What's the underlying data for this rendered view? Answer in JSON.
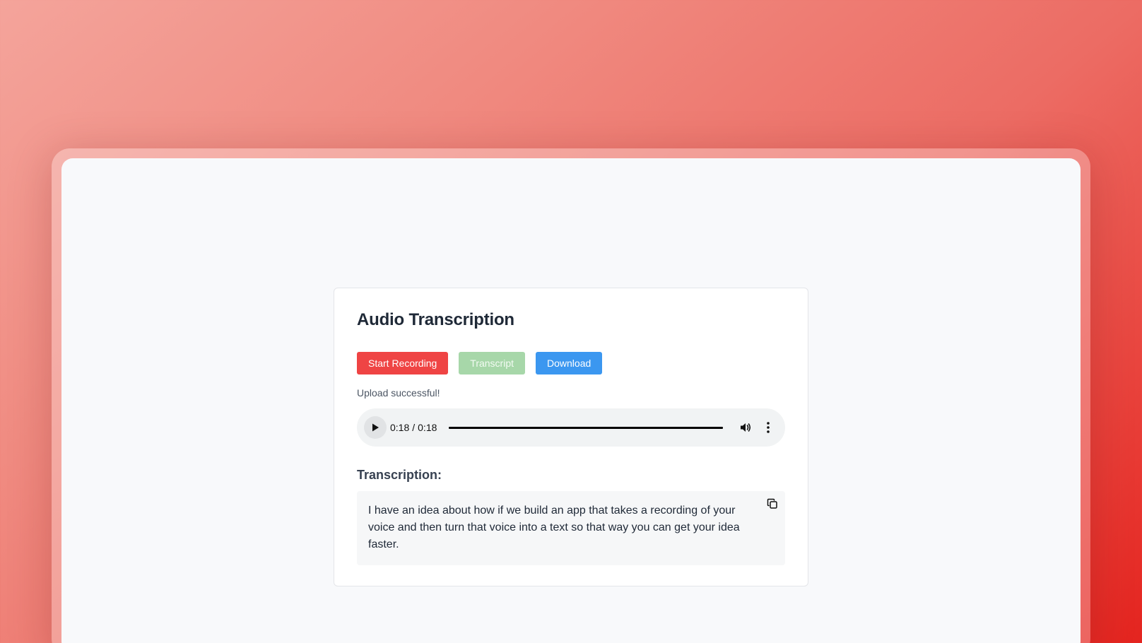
{
  "card": {
    "title": "Audio Transcription"
  },
  "buttons": {
    "start_recording": "Start Recording",
    "transcript": "Transcript",
    "download": "Download"
  },
  "status_message": "Upload successful!",
  "audio_player": {
    "current_time": "0:18",
    "duration": "0:18",
    "progress_fraction": 1.0,
    "icons": {
      "play": "play-icon",
      "volume": "volume-icon",
      "more": "more-vertical-icon"
    }
  },
  "transcription": {
    "heading": "Transcription:",
    "text": "I have an idea about how if we build an app that takes a recording of your voice and then turn that voice into a text so that way you can get your idea faster.",
    "copy_icon": "copy-icon"
  },
  "colors": {
    "record_button": "#ef4444",
    "transcript_button_disabled": "#a7d7a9",
    "download_button": "#3b97f0",
    "background_gradient_end": "#e4241f"
  }
}
